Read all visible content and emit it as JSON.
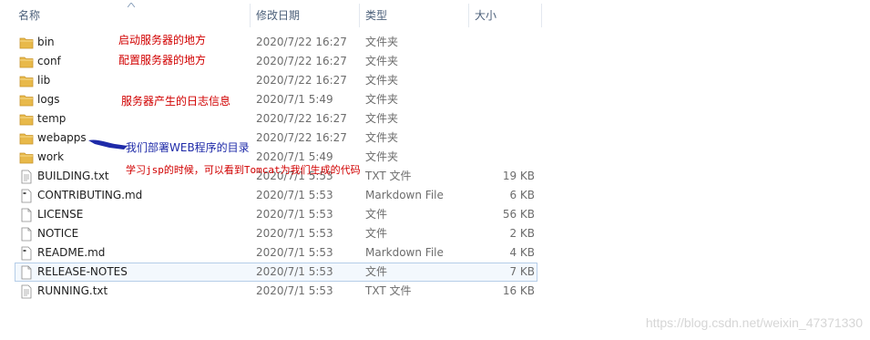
{
  "header": {
    "col_name": "名称",
    "col_date": "修改日期",
    "col_type": "类型",
    "col_size": "大小"
  },
  "files": [
    {
      "name": "bin",
      "date": "2020/7/22 16:27",
      "type": "文件夹",
      "size": "",
      "icon": "folder-icon"
    },
    {
      "name": "conf",
      "date": "2020/7/22 16:27",
      "type": "文件夹",
      "size": "",
      "icon": "folder-icon"
    },
    {
      "name": "lib",
      "date": "2020/7/22 16:27",
      "type": "文件夹",
      "size": "",
      "icon": "folder-icon"
    },
    {
      "name": "logs",
      "date": "2020/7/1 5:49",
      "type": "文件夹",
      "size": "",
      "icon": "folder-icon"
    },
    {
      "name": "temp",
      "date": "2020/7/22 16:27",
      "type": "文件夹",
      "size": "",
      "icon": "folder-icon"
    },
    {
      "name": "webapps",
      "date": "2020/7/22 16:27",
      "type": "文件夹",
      "size": "",
      "icon": "folder-icon"
    },
    {
      "name": "work",
      "date": "2020/7/1 5:49",
      "type": "文件夹",
      "size": "",
      "icon": "folder-icon"
    },
    {
      "name": "BUILDING.txt",
      "date": "2020/7/1 5:53",
      "type": "TXT 文件",
      "size": "19 KB",
      "icon": "text-file-icon"
    },
    {
      "name": "CONTRIBUTING.md",
      "date": "2020/7/1 5:53",
      "type": "Markdown File",
      "size": "6 KB",
      "icon": "markdown-file-icon"
    },
    {
      "name": "LICENSE",
      "date": "2020/7/1 5:53",
      "type": "文件",
      "size": "56 KB",
      "icon": "blank-file-icon"
    },
    {
      "name": "NOTICE",
      "date": "2020/7/1 5:53",
      "type": "文件",
      "size": "2 KB",
      "icon": "blank-file-icon"
    },
    {
      "name": "README.md",
      "date": "2020/7/1 5:53",
      "type": "Markdown File",
      "size": "4 KB",
      "icon": "markdown-file-icon"
    },
    {
      "name": "RELEASE-NOTES",
      "date": "2020/7/1 5:53",
      "type": "文件",
      "size": "7 KB",
      "icon": "blank-file-icon"
    },
    {
      "name": "RUNNING.txt",
      "date": "2020/7/1 5:53",
      "type": "TXT 文件",
      "size": "16 KB",
      "icon": "text-file-icon"
    }
  ],
  "selected_row": "RELEASE-NOTES",
  "annotations": {
    "bin": "启动服务器的地方",
    "conf": "配置服务器的地方",
    "logs": "服务器产生的日志信息",
    "webapps": "我们部署WEB程序的目录",
    "work": "学习jsp的时候，可以看到Tomcat为我们生成的代码"
  },
  "watermark": "https://blog.csdn.net/weixin_47371330",
  "colors": {
    "header_text": "#4c607a",
    "annotation_red": "#d10000",
    "annotation_blue": "#1e2aa8",
    "folder": "#e8b94a",
    "selection_border": "#b5cde8"
  }
}
